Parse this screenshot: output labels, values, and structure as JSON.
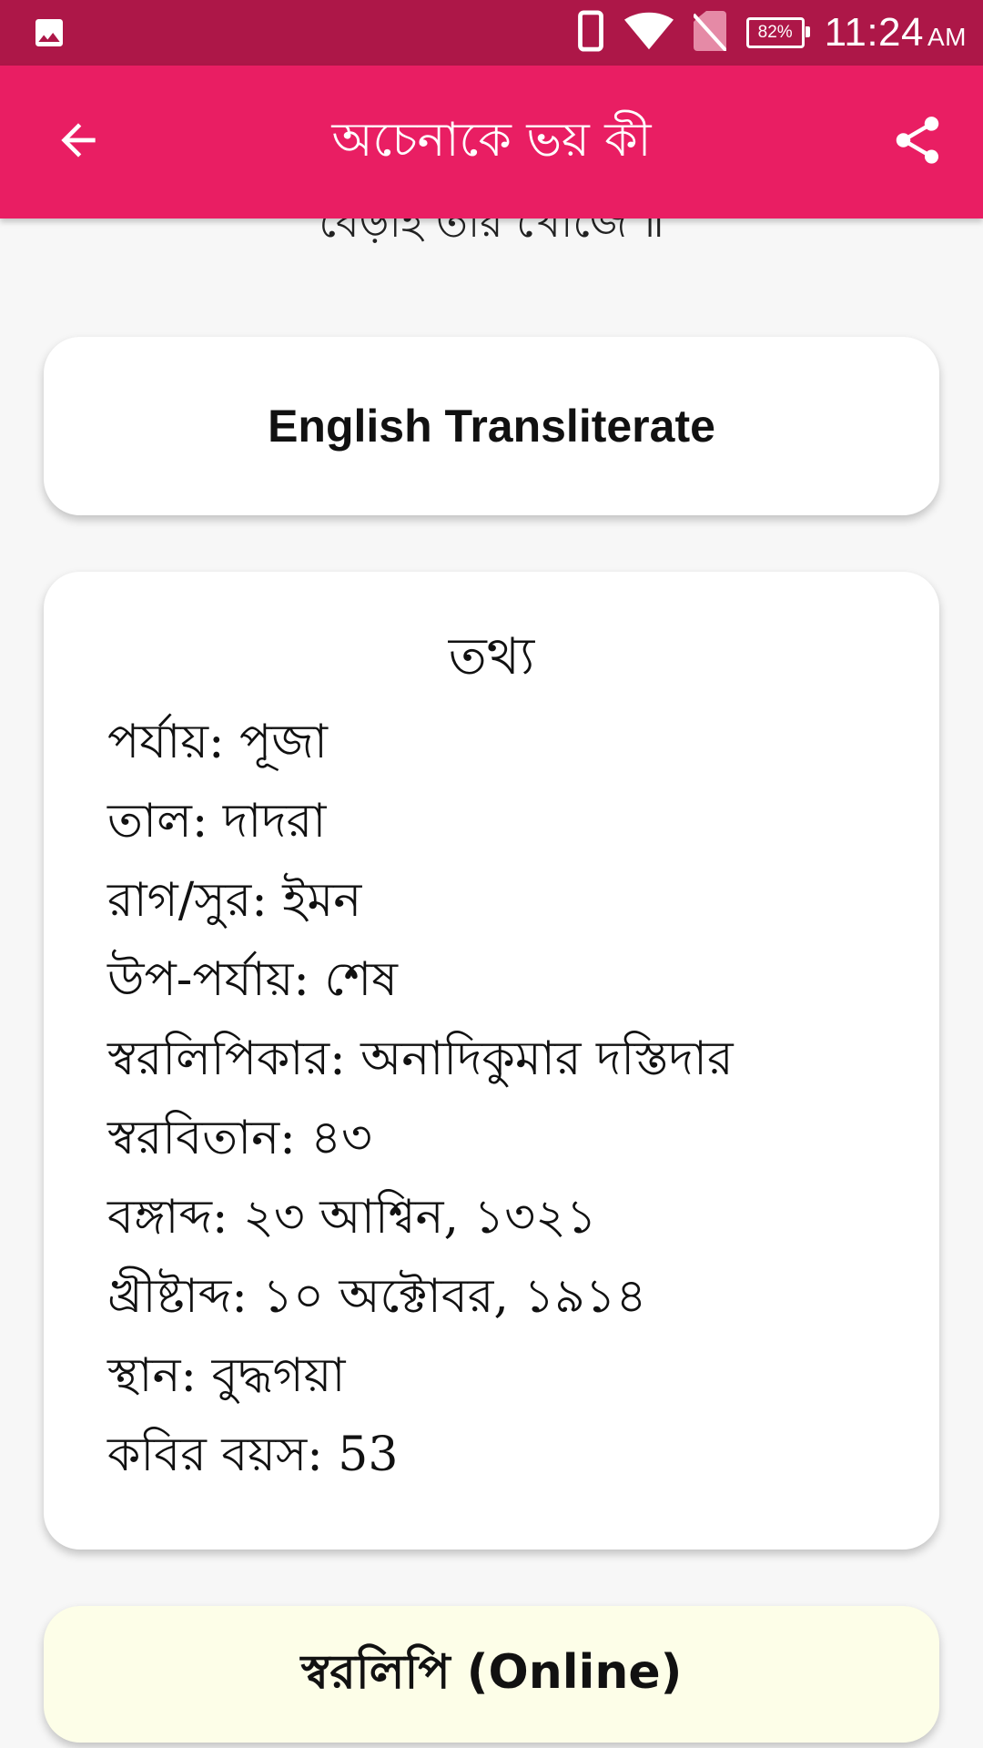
{
  "status_bar": {
    "time": "11:24",
    "ampm": "AM",
    "battery": "82%",
    "icons": [
      "image-icon",
      "phone-icon",
      "wifi-icon",
      "no-sim-icon",
      "battery-icon"
    ]
  },
  "app_bar": {
    "title": "অচেনাকে ভয় কী",
    "back_icon": "arrow-back-icon",
    "share_icon": "share-icon",
    "color": "#e91e63"
  },
  "lyric_tail": "বেড়াই তার খোঁজে ॥",
  "transliterate_button": {
    "label": "English Transliterate"
  },
  "info": {
    "title": "তথ্য",
    "rows": [
      "পর্যায়: পূজা",
      "তাল: দাদরা",
      "রাগ/সুর: ইমন",
      "উপ-পর্যায়: শেষ",
      "স্বরলিপিকার: অনাদিকুমার দস্তিদার",
      "স্বরবিতান: ৪৩",
      "বঙ্গাব্দ: ২৩ আশ্বিন, ১৩২১",
      "খ্রীষ্টাব্দ: ১০ অক্টোবর, ১৯১৪",
      "স্থান: বুদ্ধগয়া",
      "কবির বয়স: 53"
    ]
  },
  "notation_button": {
    "label": "স্বরলিপি (Online)",
    "background": "#fdfee8"
  }
}
